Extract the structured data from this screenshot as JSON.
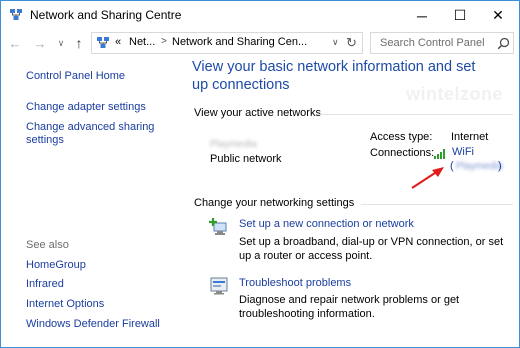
{
  "window": {
    "title": "Network and Sharing Centre",
    "controls": {
      "minimize": "─",
      "maximize": "☐",
      "close": "✕"
    }
  },
  "address_bar": {
    "nav": {
      "back": "←",
      "forward": "→",
      "dropdown": "∨",
      "up": "↑"
    },
    "crumbs": [
      "«",
      "Net...",
      ">",
      "Network and Sharing Cen..."
    ],
    "search_placeholder": "Search Control Panel"
  },
  "sidebar": {
    "items": [
      "Control Panel Home",
      "Change adapter settings",
      "Change advanced sharing settings"
    ],
    "see_also_label": "See also",
    "see_also_items": [
      "HomeGroup",
      "Infrared",
      "Internet Options",
      "Windows Defender Firewall"
    ]
  },
  "main": {
    "heading": "View your basic network information and set up connections",
    "active_networks_label": "View your active networks",
    "network": {
      "name": "Playmedia",
      "type": "Public network",
      "access_type_label": "Access type:",
      "access_type_value": "Internet",
      "connections_label": "Connections:",
      "connection_name": "WiFi",
      "connection_ssid": "Playmedia"
    },
    "watermark": "wintelzone",
    "change_settings_label": "Change your networking settings",
    "tasks": [
      {
        "link": "Set up a new connection or network",
        "desc": "Set up a broadband, dial-up or VPN connection, or set up a router or access point."
      },
      {
        "link": "Troubleshoot problems",
        "desc": "Diagnose and repair network problems or get troubleshooting information."
      }
    ]
  },
  "colors": {
    "link": "#1a3e9f",
    "heading": "#1e4aa8",
    "arrow": "#e11b1b",
    "wifi": "#2e9e2e",
    "border": "#3c8fd9"
  }
}
